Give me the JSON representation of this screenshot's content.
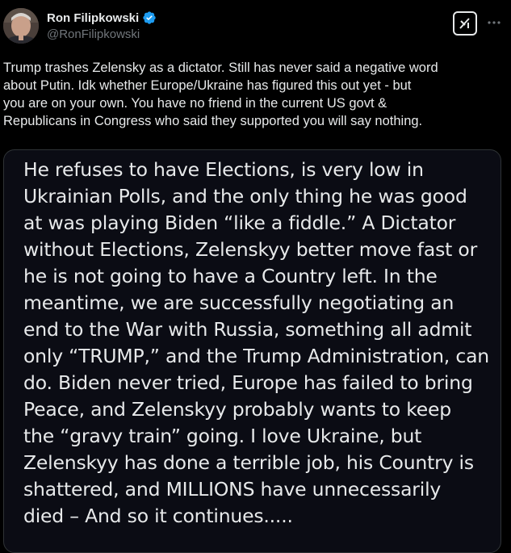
{
  "tweet": {
    "author": {
      "display_name": "Ron Filipkowski",
      "handle": "@RonFilipkowski",
      "verified": true,
      "verified_icon": "verified-badge-icon",
      "avatar_icon": "avatar-photo"
    },
    "actions": {
      "grok_icon": "grok-icon",
      "more_icon": "more-options-icon"
    },
    "text": "Trump trashes Zelensky as a dictator. Still has never said a negative word\nabout Putin. Idk whether Europe/Ukraine has figured this out yet - but\nyou are on your own. You have no friend in the current US govt &\nRepublicans in Congress who said they supported you will say nothing.",
    "quoted_image_text": "He refuses to have Elections, is very low in\nUkrainian Polls, and the only thing he was good\nat was playing Biden “like a fiddle.” A Dictator\nwithout Elections, Zelenskyy better move fast or\nhe is not going to have a Country left. In the\nmeantime, we are successfully negotiating an\nend to the War with Russia, something all admit\nonly “TRUMP,” and the Trump Administration, can\ndo. Biden never tried, Europe has failed to bring\nPeace, and Zelenskyy probably wants to keep\nthe “gravy train” going. I love Ukraine, but\nZelenskyy has done a terrible job, his Country is\nshattered, and MILLIONS have unnecessarily\ndied – And so it continues....."
  },
  "colors": {
    "background": "#000000",
    "text_primary": "#e7e9ea",
    "text_secondary": "#71767b",
    "verified_blue": "#1d9bf0",
    "card_background": "#0b0c14",
    "card_border": "#2f3336"
  }
}
